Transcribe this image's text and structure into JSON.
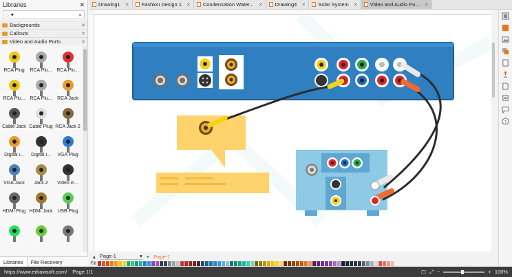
{
  "library": {
    "title": "Libraries",
    "categories": [
      {
        "label": "Backgrounds"
      },
      {
        "label": "Callouts"
      },
      {
        "label": "Video and Audio Ports"
      }
    ],
    "items": [
      {
        "label": "RCA Plug",
        "icon": "rca-plug-yellow-icon"
      },
      {
        "label": "RCA Plu...",
        "icon": "rca-plug-gray-icon"
      },
      {
        "label": "RCA Plu...",
        "icon": "rca-plug-red-icon"
      },
      {
        "label": "RCA Plu...",
        "icon": "rca-plug-2-icon"
      },
      {
        "label": "RCA Plu...",
        "icon": "rca-plug-3-icon"
      },
      {
        "label": "RCA Jack",
        "icon": "rca-jack-icon"
      },
      {
        "label": "Cable Jack",
        "icon": "cable-jack-icon"
      },
      {
        "label": "Cable Plug",
        "icon": "cable-plug-icon"
      },
      {
        "label": "RCA Jack 2",
        "icon": "rca-jack-2-icon"
      },
      {
        "label": "Digital i...",
        "icon": "digital-in-icon"
      },
      {
        "label": "Digital i...",
        "icon": "digital-in-2-icon"
      },
      {
        "label": "VGA Plug",
        "icon": "vga-plug-icon"
      },
      {
        "label": "VGA Jack",
        "icon": "vga-jack-icon"
      },
      {
        "label": "Jack 2",
        "icon": "jack-2-icon"
      },
      {
        "label": "Video in...",
        "icon": "video-in-icon"
      },
      {
        "label": "HDMI Plug",
        "icon": "hdmi-plug-icon"
      },
      {
        "label": "HDMI Jack",
        "icon": "hdmi-jack-icon"
      },
      {
        "label": "USB Plug",
        "icon": "usb-plug-icon"
      },
      {
        "label": "",
        "icon": "s-video-icon"
      },
      {
        "label": "",
        "icon": "plug-green-icon"
      },
      {
        "label": "",
        "icon": "connector-icon"
      }
    ],
    "tabs": [
      "Libraries",
      "File Recovery"
    ]
  },
  "doc_tabs": [
    {
      "label": "Drawing1",
      "active": false
    },
    {
      "label": "Fashion Design 1",
      "active": false
    },
    {
      "label": "Condensation Water...",
      "active": false
    },
    {
      "label": "Drawing4",
      "active": false
    },
    {
      "label": "Solar System",
      "active": false
    },
    {
      "label": "Video and Audio Po...",
      "active": true
    }
  ],
  "page_bar": {
    "page_select": "Page-1",
    "add": "+",
    "current_page": "Page-1"
  },
  "palette": {
    "fill_label": "Fill"
  },
  "status": {
    "url": "https://www.edrawsoft.com/",
    "page": "Page 1/1",
    "zoom": "100%"
  },
  "colors": {
    "accent": "#e07a1f",
    "device_blue": "#2f7fc1",
    "receiver_blue": "#8ecae6",
    "callout_yellow": "#ffd36b"
  }
}
